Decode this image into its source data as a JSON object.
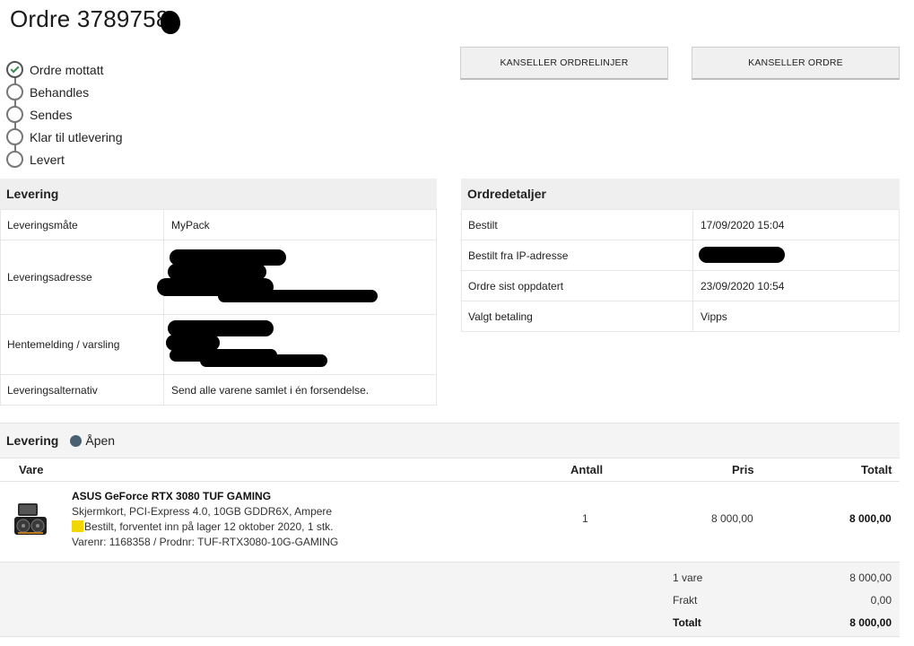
{
  "order": {
    "title": "Ordre 3789758"
  },
  "steps": [
    {
      "label": "Ordre mottatt",
      "done": true
    },
    {
      "label": "Behandles",
      "done": false
    },
    {
      "label": "Sendes",
      "done": false
    },
    {
      "label": "Klar til utlevering",
      "done": false
    },
    {
      "label": "Levert",
      "done": false
    }
  ],
  "buttons": {
    "cancel_lines": "KANSELLER ORDRELINJER",
    "cancel_order": "KANSELLER ORDRE"
  },
  "levering": {
    "heading": "Levering",
    "rows": [
      {
        "key": "Leveringsmåte",
        "value": "MyPack"
      },
      {
        "key": "Leveringsadresse",
        "value": ""
      },
      {
        "key": "Hentemelding / varsling",
        "value": ""
      },
      {
        "key": "Leveringsalternativ",
        "value": "Send alle varene samlet i én forsendelse."
      }
    ]
  },
  "ordredetaljer": {
    "heading": "Ordredetaljer",
    "rows": [
      {
        "key": "Bestilt",
        "value": "17/09/2020 15:04"
      },
      {
        "key": "Bestilt fra IP-adresse",
        "value": ""
      },
      {
        "key": "Ordre sist oppdatert",
        "value": "23/09/2020 10:54"
      },
      {
        "key": "Valgt betaling",
        "value": "Vipps"
      }
    ]
  },
  "delivery": {
    "heading": "Levering",
    "status": "Åpen",
    "status_color": "#4a6173",
    "columns": {
      "vare": "Vare",
      "antall": "Antall",
      "pris": "Pris",
      "totalt": "Totalt"
    },
    "item": {
      "name": "ASUS GeForce RTX 3080 TUF GAMING",
      "desc": "Skjermkort, PCI-Express 4.0, 10GB GDDR6X, Ampere",
      "stock": "Bestilt, forventet inn på lager 12 oktober 2020, 1 stk.",
      "ids": "Varenr: 1168358 / Prodnr: TUF-RTX3080-10G-GAMING",
      "qty": "1",
      "price": "8 000,00",
      "total": "8 000,00",
      "icon": "graphics-card-icon"
    },
    "summary": [
      {
        "label": "1 vare",
        "value": "8 000,00"
      },
      {
        "label": "Frakt",
        "value": "0,00"
      },
      {
        "label": "Totalt",
        "value": "8 000,00"
      }
    ]
  },
  "colors": {
    "accent_check": "#3a8a50",
    "stock_flag": "#f2d600",
    "header_bg": "#efefef"
  }
}
